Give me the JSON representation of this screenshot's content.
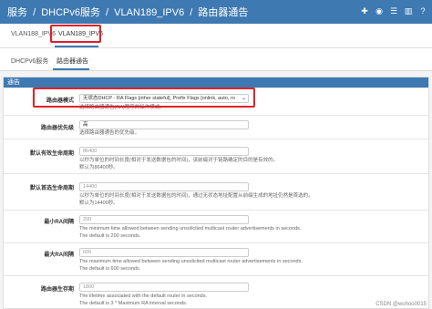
{
  "header": {
    "breadcrumb": [
      "服务",
      "/",
      "DHCPv6服务",
      "/",
      "VLAN189_IPV6",
      "/",
      "路由器通告"
    ],
    "icons": [
      "plus-icon",
      "stop-icon",
      "menu-icon",
      "chart-icon",
      "help-icon"
    ]
  },
  "tabs1": [
    "VLAN188_IPV6",
    "VLAN189_IPV6"
  ],
  "tabs2": [
    "DHCPv6服务",
    "路由器通告"
  ],
  "panel_title": "通告",
  "rows": [
    {
      "label": "路由器模式",
      "value": "无状态DHCP - RA Flags [other stateful], Prefix Flags [onlink, auto, ro",
      "help": [
        "选择路由器通告(RA)程序的操作模式。"
      ]
    },
    {
      "label": "路由器优先级",
      "value": "高",
      "help": [
        "选择路由器通告的优先级。"
      ]
    },
    {
      "label": "默认有效生命周期",
      "value": "86400",
      "help": [
        "以秒为单位的时间长度(相对于发送数据包的时间)，该前缀对于链路确定的目的是有效的。",
        "默认为86400秒。"
      ]
    },
    {
      "label": "默认首选生命周期",
      "value": "14400",
      "help": [
        "以秒为单位的时间长度(相对于发送数据包的时间)，通过无状态地址配置从前缀生成的地址仍然是首选的。",
        "默认为14400秒。"
      ]
    },
    {
      "label": "最小RA间隔",
      "value": "200",
      "help": [
        "The minimum time allowed between sending unsolicited multicast router advertisements in seconds.",
        "The default is 200 seconds."
      ]
    },
    {
      "label": "最大RA间隔",
      "value": "600",
      "help": [
        "The maximum time allowed between sending unsolicited multicast router advertisements in seconds.",
        "The default is 600 seconds."
      ]
    },
    {
      "label": "路由器生存期",
      "value": "1800",
      "help": [
        "The lifetime associated with the default router in seconds.",
        "The default is 3 * Maximum RA interval seconds."
      ]
    }
  ],
  "watermark": "CSDN @wohoo0015",
  "colors": {
    "header": "#3e79b2",
    "highlight": "#e0202a"
  }
}
